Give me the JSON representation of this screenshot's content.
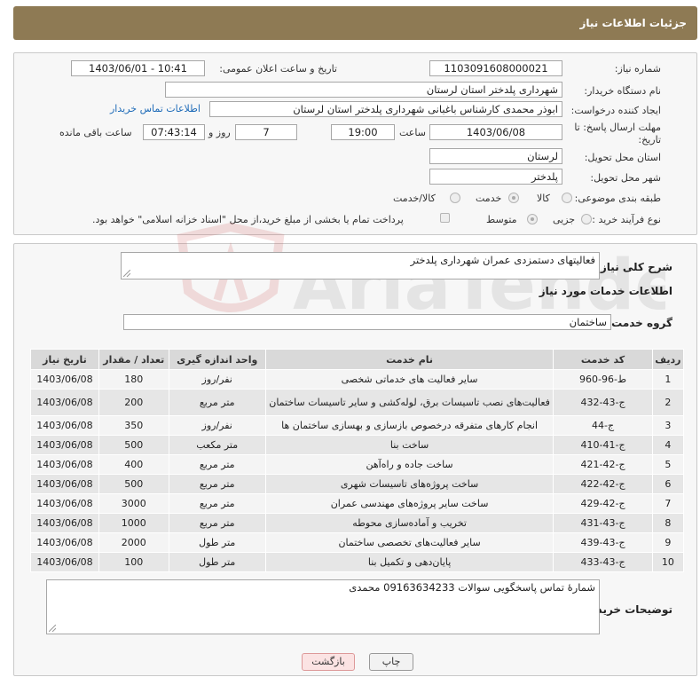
{
  "header": {
    "title": "جزئیات اطلاعات نیاز"
  },
  "form": {
    "need_number_label": "شماره نیاز:",
    "need_number": "1103091608000021",
    "announce_label": "تاریخ و ساعت اعلان عمومی:",
    "announce_value": "1403/06/01 - 10:41",
    "buyer_org_label": "نام دستگاه خریدار:",
    "buyer_org": "شهرداری پلدختر استان لرستان",
    "requester_label": "ایجاد کننده درخواست:",
    "requester": "ابوذر محمدی کارشناس باغبانی شهرداری پلدختر استان لرستان",
    "contact_link": "اطلاعات تماس خریدار",
    "deadline_label": "مهلت ارسال پاسخ: تا تاریخ:",
    "deadline_date": "1403/06/08",
    "hour_label": "ساعت",
    "deadline_time": "19:00",
    "days_value": "7",
    "days_label": "روز و",
    "remaining_time": "07:43:14",
    "remaining_label": "ساعت باقی مانده",
    "province_label": "استان محل تحویل:",
    "province": "لرستان",
    "city_label": "شهر محل تحویل:",
    "city": "پلدختر",
    "category_label": "طبقه بندی موضوعی:",
    "category_options": [
      "کالا",
      "خدمت",
      "کالا/خدمت"
    ],
    "category_selected": "خدمت",
    "process_label": "نوع فرآیند خرید :",
    "process_options": [
      "جزیی",
      "متوسط"
    ],
    "process_selected": "متوسط",
    "payment_note": "پرداخت تمام یا بخشی از مبلغ خرید،از محل \"اسناد خزانه اسلامی\" خواهد بود."
  },
  "summary": {
    "label": "شرح کلی نیاز:",
    "value": "فعالیتهای دستمزدی عمران شهرداری پلدختر"
  },
  "services": {
    "heading": "اطلاعات خدمات مورد نیاز",
    "group_label": "گروه خدمت:",
    "group_value": "ساختمان",
    "columns": [
      "ردیف",
      "کد خدمت",
      "نام خدمت",
      "واحد اندازه گیری",
      "تعداد / مقدار",
      "تاریخ نیاز"
    ],
    "rows": [
      [
        "1",
        "ط-96-960",
        "سایر فعالیت های خدماتی شخصی",
        "نفر/روز",
        "180",
        "1403/06/08"
      ],
      [
        "2",
        "ج-43-432",
        "فعالیت‌های نصب تاسیسات برق، لوله‌کشی و سایر تاسیسات ساختمان",
        "متر مربع",
        "200",
        "1403/06/08"
      ],
      [
        "3",
        "ج-44",
        "انجام کارهای متفرقه درخصوص بازسازی و بهسازی ساختمان ها",
        "نفر/روز",
        "350",
        "1403/06/08"
      ],
      [
        "4",
        "ج-41-410",
        "ساخت بنا",
        "متر مکعب",
        "500",
        "1403/06/08"
      ],
      [
        "5",
        "ج-42-421",
        "ساخت جاده و راه‌آهن",
        "متر مربع",
        "400",
        "1403/06/08"
      ],
      [
        "6",
        "ج-42-422",
        "ساخت پروژه‌های تاسیسات شهری",
        "متر مربع",
        "500",
        "1403/06/08"
      ],
      [
        "7",
        "ج-42-429",
        "ساخت سایر پروژه‌های مهندسی عمران",
        "متر مربع",
        "3000",
        "1403/06/08"
      ],
      [
        "8",
        "ج-43-431",
        "تخریب و آماده‌سازی محوطه",
        "متر مربع",
        "1000",
        "1403/06/08"
      ],
      [
        "9",
        "ج-43-439",
        "سایر فعالیت‌های تخصصی ساختمان",
        "متر طول",
        "2000",
        "1403/06/08"
      ],
      [
        "10",
        "ج-43-433",
        "پایان‌دهی و تکمیل بنا",
        "متر طول",
        "100",
        "1403/06/08"
      ]
    ]
  },
  "buyer_notes": {
    "label": "توضیحات خریدار:",
    "value": "شمارۀ تماس پاسخگویی سوالات 09163634233 محمدی"
  },
  "buttons": {
    "print": "چاپ",
    "back": "بازگشت"
  },
  "watermark": {
    "text": "AriaTender.neT"
  },
  "colors": {
    "header": "#8e7a54",
    "link": "#1e6bb8",
    "back_button": "#fbe3e3"
  }
}
